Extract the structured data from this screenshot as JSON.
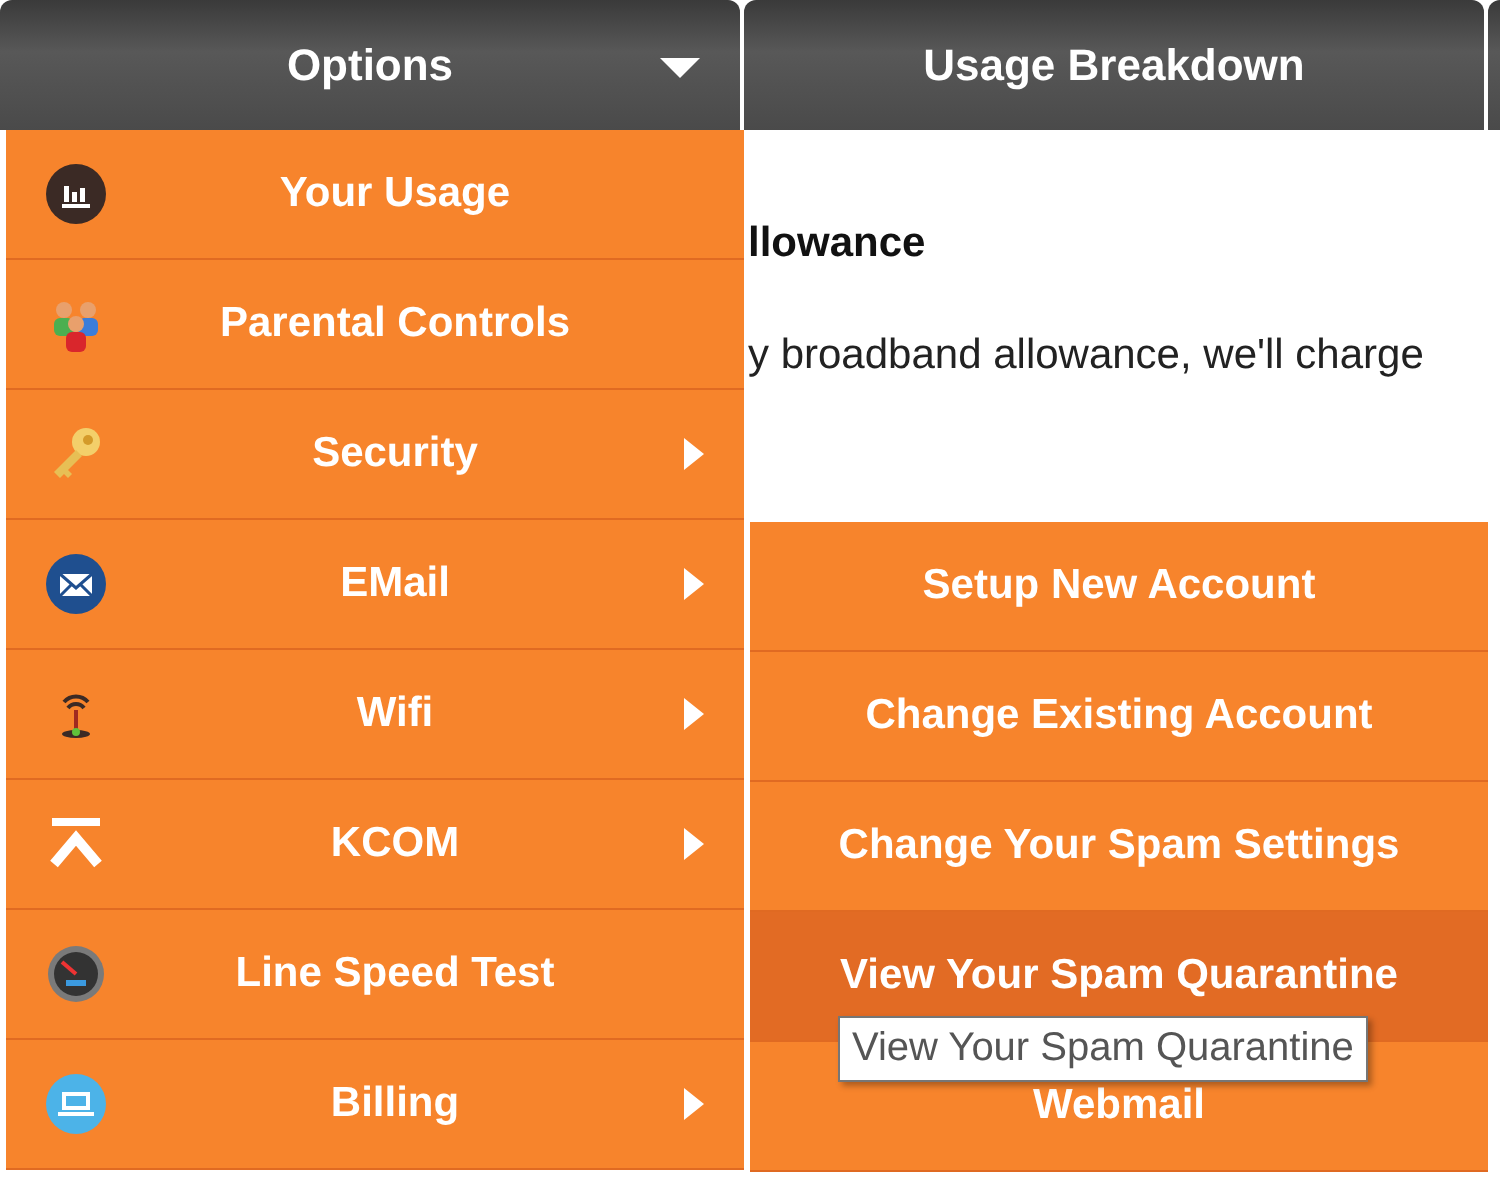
{
  "header": {
    "tabs": [
      {
        "label": "Options",
        "dropdown": true
      },
      {
        "label": "Usage Breakdown",
        "dropdown": false
      }
    ]
  },
  "content": [
    {
      "kind": "heading",
      "text": "llowance"
    },
    {
      "kind": "paragraph",
      "text": "y broadband allowance, we'll charge"
    }
  ],
  "menu": {
    "items": [
      {
        "label": "Your Usage",
        "submenu": false
      },
      {
        "label": "Parental Controls",
        "submenu": false
      },
      {
        "label": "Security",
        "submenu": true
      },
      {
        "label": "EMail",
        "submenu": true
      },
      {
        "label": "Wifi",
        "submenu": true
      },
      {
        "label": "KCOM",
        "submenu": true
      },
      {
        "label": "Line Speed Test",
        "submenu": false
      },
      {
        "label": "Billing",
        "submenu": true
      }
    ]
  },
  "submenu": {
    "items": [
      {
        "label": "Setup New Account",
        "selected": false
      },
      {
        "label": "Change Existing Account",
        "selected": false
      },
      {
        "label": "Change Your Spam Settings",
        "selected": false
      },
      {
        "label": "View Your Spam Quarantine",
        "selected": true
      },
      {
        "label": "Webmail",
        "selected": false
      }
    ]
  },
  "tooltip": {
    "text": "View Your Spam Quarantine"
  }
}
